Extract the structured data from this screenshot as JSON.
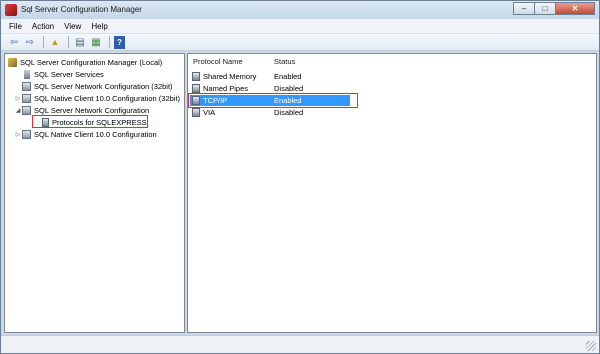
{
  "window": {
    "title": "Sql Server Configuration Manager",
    "min_glyph": "–",
    "max_glyph": "□",
    "close_glyph": "✕"
  },
  "menu": [
    "File",
    "Action",
    "View",
    "Help"
  ],
  "toolbar": {
    "back_glyph": "⇦",
    "forward_glyph": "⇨",
    "up_glyph": "▲",
    "properties_glyph": "▤",
    "export_glyph": "▦",
    "help_glyph": "?"
  },
  "tree": {
    "root": "SQL Server Configuration Manager (Local)",
    "items": [
      {
        "label": "SQL Server Services",
        "toggle": ""
      },
      {
        "label": "SQL Server Network Configuration (32bit)",
        "toggle": ""
      },
      {
        "label": "SQL Native Client 10.0 Configuration (32bit)",
        "toggle": "▷"
      },
      {
        "label": "SQL Server Network Configuration",
        "toggle": "◢"
      },
      {
        "label": "Protocols for SQLEXPRESS",
        "toggle": ""
      },
      {
        "label": "SQL Native Client 10.0 Configuration",
        "toggle": "▷"
      }
    ]
  },
  "list": {
    "headers": {
      "name": "Protocol Name",
      "status": "Status"
    },
    "rows": [
      {
        "name": "Shared Memory",
        "status": "Enabled"
      },
      {
        "name": "Named Pipes",
        "status": "Disabled"
      },
      {
        "name": "TCP/IP",
        "status": "Enabled"
      },
      {
        "name": "VIA",
        "status": "Disabled"
      }
    ],
    "selected_index": 2
  },
  "colors": {
    "selection": "#3399ff",
    "highlight_outline": "#e03030",
    "window_frame": "#c9d9ea"
  }
}
